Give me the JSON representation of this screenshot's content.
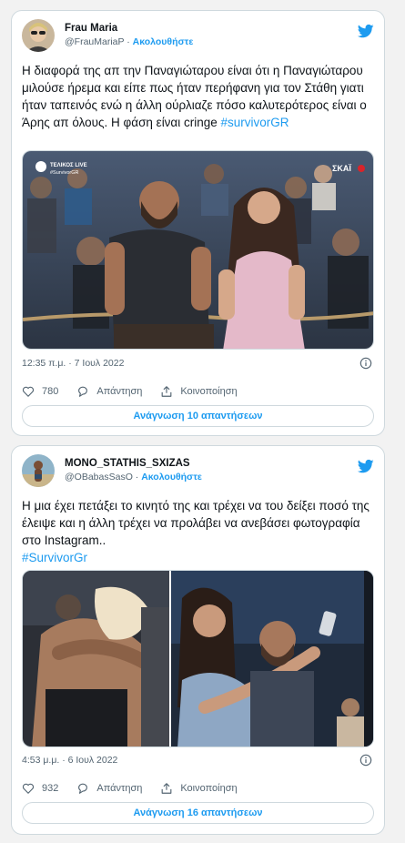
{
  "tweets": [
    {
      "display_name": "Frau Maria",
      "handle": "@FrauMariaP",
      "separator": " · ",
      "follow_label": "Ακολουθήστε",
      "text": "Η διαφορά της απ την Παναγιώταρου είναι ότι η Παναγιώταρου μιλούσε ήρεμα και είπε πως ήταν περήφανη για τον Στάθη γιατι ήταν ταπεινός ενώ η άλλη ούρλιαζε πόσο καλυτερότερος είναι ο Άρης απ όλους. Η φάση είναι cringe ",
      "hashtag": "#survivorGR",
      "timestamp": "12:35 π.μ. · 7 Ιουλ 2022",
      "likes": "780",
      "reply_label": "Απάντηση",
      "share_label": "Κοινοποίηση",
      "read_replies_label": "Ανάγνωση 10 απαντήσεων",
      "media_overlay_left": "ΤΕΛΙΚΟΣ LIVE",
      "media_overlay_left_sub": "#SurvivorGR",
      "media_overlay_right": "ΣΚΑΪ"
    },
    {
      "display_name": "MONO_STATHIS_SXIZAS",
      "handle": "@OBabasSasO",
      "separator": " · ",
      "follow_label": "Ακολουθήστε",
      "text": "Η μια έχει πετάξει το κινητό της και τρέχει να του δείξει ποσό της έλειψε και η άλλη τρέχει να προλάβει να ανεβάσει φωτογραφία στο Instagram..",
      "hashtag": "#SurvivorGr",
      "timestamp": "4:53 μ.μ. · 6 Ιουλ 2022",
      "likes": "932",
      "reply_label": "Απάντηση",
      "share_label": "Κοινοποίηση",
      "read_replies_label": "Ανάγνωση 16 απαντήσεων"
    }
  ],
  "icons": {
    "brand": "twitter-bird-icon",
    "info": "info-icon",
    "like": "heart-icon",
    "reply": "reply-bubble-icon",
    "share": "share-upload-icon"
  },
  "colors": {
    "accent": "#1d9bf0",
    "text": "#0f1419",
    "muted": "#536471",
    "border": "#cfd9de",
    "background": "#f2f2f2"
  }
}
